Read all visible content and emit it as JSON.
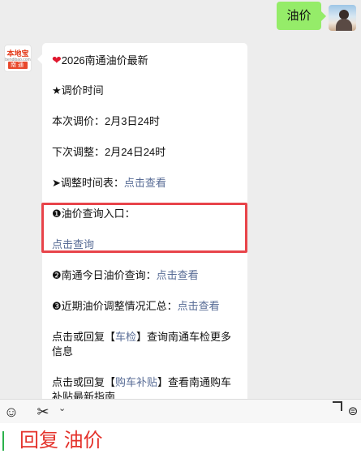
{
  "user_message": {
    "text": "油价"
  },
  "bot": {
    "avatar_top_text": "本地宝",
    "avatar_url_text": "bendibao.com",
    "avatar_city": "南通"
  },
  "message": {
    "heading": "2026南通油价最新",
    "section_title": "★调价时间",
    "current_adjust": "本次调价：2月3日24时",
    "next_adjust": "下次调整：2月24日24时",
    "schedule_prefix": "➤调整时间表：",
    "schedule_link": "点击查看",
    "query_entry": "❶油价查询入口：",
    "query_link": "点击查询",
    "today_prefix": "❷南通今日油价查询：",
    "today_link": "点击查看",
    "recent_prefix": "❸近期油价调整情况汇总：",
    "recent_link": "点击查看",
    "inspect_prefix": "点击或回复【",
    "inspect_link": "车检",
    "inspect_suffix": "】查询南通车检更多信息",
    "subsidy_prefix": "点击或回复【",
    "subsidy_link": "购车补贴",
    "subsidy_suffix": "】查看南通购车补贴最新指南"
  },
  "caption": "回复 油价",
  "icons": [
    "heart-icon",
    "emoji-icon",
    "scissors-icon",
    "chevron-down-icon",
    "more-icon"
  ],
  "colors": {
    "user_bubble": "#95ec69",
    "link": "#576b95",
    "highlight": "#e8444a",
    "caption": "#e4322b"
  }
}
